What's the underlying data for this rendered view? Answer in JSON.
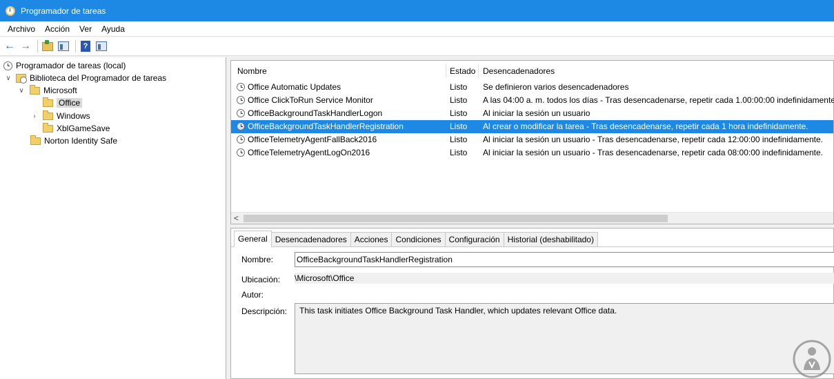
{
  "window": {
    "title": "Programador de tareas"
  },
  "menu": [
    "Archivo",
    "Acción",
    "Ver",
    "Ayuda"
  ],
  "toolbar": {
    "buttons": [
      "back-arrow-icon",
      "forward-arrow-icon",
      "folder-up-icon",
      "show-hide-pane-icon",
      "help-icon",
      "action-pane-icon"
    ]
  },
  "tree": {
    "root": "Programador de tareas (local)",
    "library": "Biblioteca del Programador de tareas",
    "microsoft": "Microsoft",
    "office": "Office",
    "windows": "Windows",
    "xbl": "XblGameSave",
    "norton": "Norton Identity Safe"
  },
  "task_list": {
    "columns": [
      "Nombre",
      "Estado",
      "Desencadenadores"
    ],
    "rows": [
      {
        "name": "Office Automatic Updates",
        "state": "Listo",
        "trigger": "Se definieron varios desencadenadores"
      },
      {
        "name": "Office ClickToRun Service Monitor",
        "state": "Listo",
        "trigger": "A las 04:00 a. m. todos los días - Tras desencadenarse, repetir cada 1.00:00:00 indefinidamente."
      },
      {
        "name": "OfficeBackgroundTaskHandlerLogon",
        "state": "Listo",
        "trigger": "Al iniciar la sesión un usuario"
      },
      {
        "name": "OfficeBackgroundTaskHandlerRegistration",
        "state": "Listo",
        "trigger": "Al crear o modificar la tarea - Tras desencadenarse, repetir cada 1 hora indefinidamente."
      },
      {
        "name": "OfficeTelemetryAgentFallBack2016",
        "state": "Listo",
        "trigger": "Al iniciar la sesión un usuario - Tras desencadenarse, repetir cada 12:00:00 indefinidamente."
      },
      {
        "name": "OfficeTelemetryAgentLogOn2016",
        "state": "Listo",
        "trigger": "Al iniciar la sesión un usuario - Tras desencadenarse, repetir cada 08:00:00 indefinidamente."
      }
    ],
    "selected_index": 3,
    "scroll_left_glyph": "<"
  },
  "details": {
    "tabs": [
      "General",
      "Desencadenadores",
      "Acciones",
      "Condiciones",
      "Configuración",
      "Historial (deshabilitado)"
    ],
    "active_tab": "General",
    "labels": {
      "name": "Nombre:",
      "location": "Ubicación:",
      "author": "Autor:",
      "description": "Descripción:"
    },
    "values": {
      "name": "OfficeBackgroundTaskHandlerRegistration",
      "location": "\\Microsoft\\Office",
      "author": "",
      "description": "This task initiates Office Background Task Handler, which updates relevant Office data."
    }
  },
  "colors": {
    "title_bar": "#1e88e5",
    "selection": "#1e88e5",
    "watermark": "#8a8a8a"
  },
  "watermark": {
    "icon": "person-help-logo"
  }
}
